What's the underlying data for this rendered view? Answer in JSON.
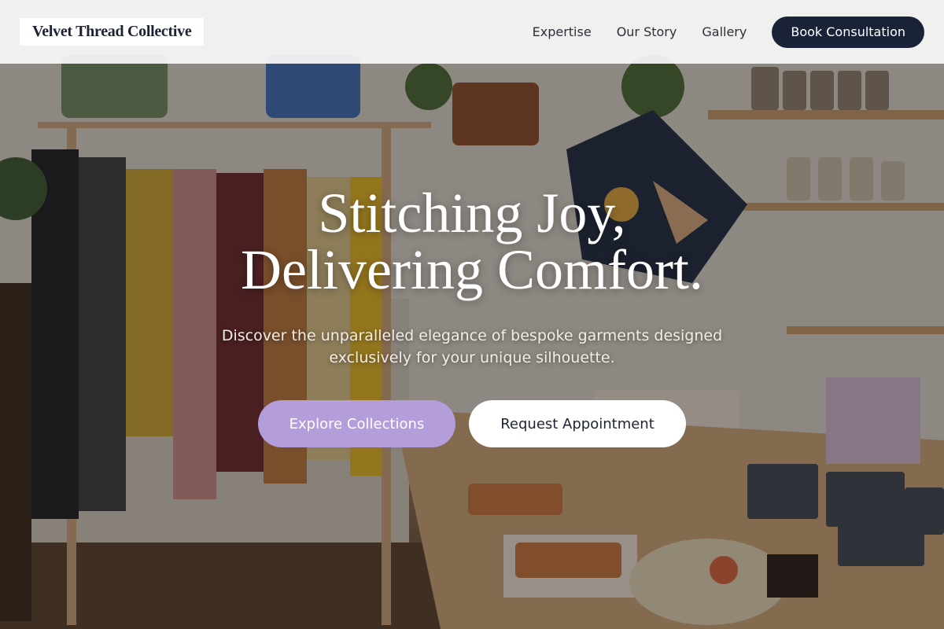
{
  "header": {
    "logo_text": "Velvet Thread Collective",
    "nav": [
      "Expertise",
      "Our Story",
      "Gallery"
    ],
    "cta_label": "Book Consultation"
  },
  "hero": {
    "title_line1": "Stitching Joy,",
    "title_line2": "Delivering Comfort.",
    "subtitle": "Discover the unparalleled elegance of bespoke garments designed exclusively for your unique silhouette.",
    "primary_button": "Explore Collections",
    "secondary_button": "Request Appointment",
    "background_description_icon": "boutique-photo"
  },
  "colors": {
    "header_bg": "#f7f7f8",
    "cta_bg": "#1a2238",
    "primary_button_bg": "#b39ddb",
    "secondary_button_bg": "#ffffff"
  }
}
